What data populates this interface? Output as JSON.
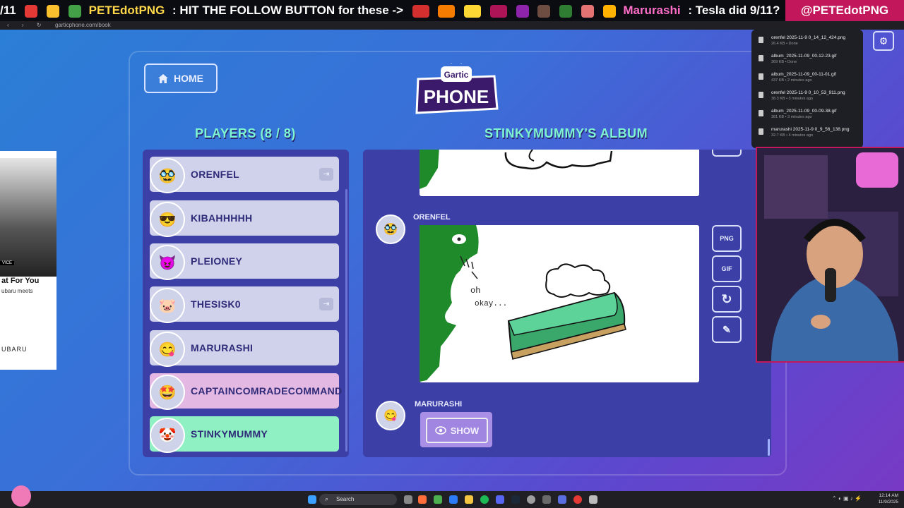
{
  "ticker": {
    "prefix": "/11",
    "user1": "PETEdotPNG",
    "msg1": ":  HIT THE FOLLOW BUTTON for these ->",
    "user2": "Marurashi",
    "msg2": ":  Tesla did 9/11?",
    "handle": "@PETEdotPNG"
  },
  "browser": {
    "url": "garticphone.com/book"
  },
  "game": {
    "home_label": "HOME",
    "logo_top": "Gartic",
    "logo_bottom": "PHONE",
    "players_title": "PLAYERS (8 / 8)",
    "album_title": "STINKYMUMMY'S ALBUM",
    "players": [
      {
        "name": "ORENFEL",
        "avatar": "🥸"
      },
      {
        "name": "KIBAHHHHH",
        "avatar": "😎"
      },
      {
        "name": "PLEIONEY",
        "avatar": "😈"
      },
      {
        "name": "THESISK0",
        "avatar": "🐷"
      },
      {
        "name": "MARURASHI",
        "avatar": "😋"
      },
      {
        "name": "CAPTAINCOMRADECOMMAND",
        "avatar": "🤩"
      },
      {
        "name": "STINKYMUMMY",
        "avatar": "🤡"
      }
    ],
    "album": {
      "entry1_name": "ORENFEL",
      "entry2_name": "MARURASHI",
      "drawing_text1": "oh",
      "drawing_text2": "okay...",
      "show_label": "SHOW",
      "png_label": "PNG",
      "gif_label": "GIF"
    }
  },
  "downloads": [
    {
      "name": "orenfel 2025-11-9 0_14_12_424.png",
      "meta": "26.4 KB • Done"
    },
    {
      "name": "album_2025-11-09_00-12-23.gif",
      "meta": "369 KB • Done"
    },
    {
      "name": "album_2025-11-09_00-11-01.gif",
      "meta": "437 KB • 2 minutes ago"
    },
    {
      "name": "orenfel 2025-11-9 0_10_53_911.png",
      "meta": "38.3 KB • 3 minutes ago"
    },
    {
      "name": "album_2025-11-09_00-09-38.gif",
      "meta": "381 KB • 3 minutes ago"
    },
    {
      "name": "marurashi 2025-11-9 0_9_56_138.png",
      "meta": "32.7 KB • 4 minutes ago"
    }
  ],
  "ad": {
    "headline": "at For You",
    "subline": "ubaru meets",
    "brand": "UBARU",
    "tag": "VICE"
  },
  "taskbar": {
    "search_placeholder": "Search",
    "time": "12:14 AM",
    "date": "11/9/2025"
  },
  "colors": {
    "accent_teal": "#7ff5d1",
    "panel": "#3c40a6",
    "active_player": "#8ff0c4",
    "handle_bg": "#c2185b"
  }
}
